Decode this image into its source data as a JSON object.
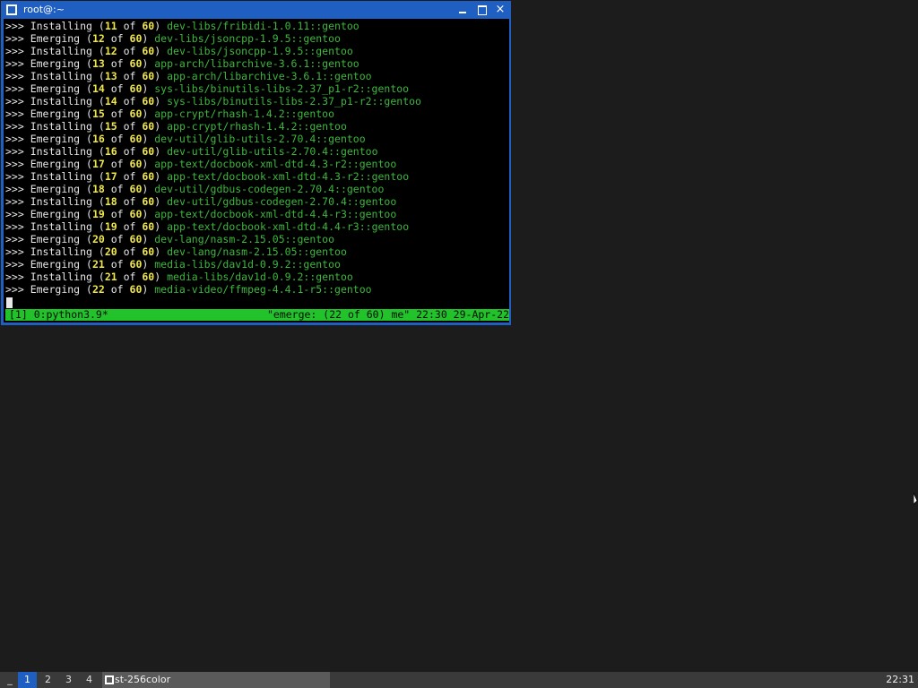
{
  "window": {
    "title": "root@:~",
    "minimize_label": "minimize",
    "maximize_label": "maximize",
    "close_label": "×"
  },
  "terminal": {
    "lines": [
      {
        "prompt": ">>> ",
        "verb": "Installing",
        "num": "11",
        "total": "60",
        "pkg": "dev-libs/fribidi-1.0.11::gentoo"
      },
      {
        "prompt": ">>> ",
        "verb": "Emerging",
        "num": "12",
        "total": "60",
        "pkg": "dev-libs/jsoncpp-1.9.5::gentoo"
      },
      {
        "prompt": ">>> ",
        "verb": "Installing",
        "num": "12",
        "total": "60",
        "pkg": "dev-libs/jsoncpp-1.9.5::gentoo"
      },
      {
        "prompt": ">>> ",
        "verb": "Emerging",
        "num": "13",
        "total": "60",
        "pkg": "app-arch/libarchive-3.6.1::gentoo"
      },
      {
        "prompt": ">>> ",
        "verb": "Installing",
        "num": "13",
        "total": "60",
        "pkg": "app-arch/libarchive-3.6.1::gentoo"
      },
      {
        "prompt": ">>> ",
        "verb": "Emerging",
        "num": "14",
        "total": "60",
        "pkg": "sys-libs/binutils-libs-2.37_p1-r2::gentoo"
      },
      {
        "prompt": ">>> ",
        "verb": "Installing",
        "num": "14",
        "total": "60",
        "pkg": "sys-libs/binutils-libs-2.37_p1-r2::gentoo"
      },
      {
        "prompt": ">>> ",
        "verb": "Emerging",
        "num": "15",
        "total": "60",
        "pkg": "app-crypt/rhash-1.4.2::gentoo"
      },
      {
        "prompt": ">>> ",
        "verb": "Installing",
        "num": "15",
        "total": "60",
        "pkg": "app-crypt/rhash-1.4.2::gentoo"
      },
      {
        "prompt": ">>> ",
        "verb": "Emerging",
        "num": "16",
        "total": "60",
        "pkg": "dev-util/glib-utils-2.70.4::gentoo"
      },
      {
        "prompt": ">>> ",
        "verb": "Installing",
        "num": "16",
        "total": "60",
        "pkg": "dev-util/glib-utils-2.70.4::gentoo"
      },
      {
        "prompt": ">>> ",
        "verb": "Emerging",
        "num": "17",
        "total": "60",
        "pkg": "app-text/docbook-xml-dtd-4.3-r2::gentoo"
      },
      {
        "prompt": ">>> ",
        "verb": "Installing",
        "num": "17",
        "total": "60",
        "pkg": "app-text/docbook-xml-dtd-4.3-r2::gentoo"
      },
      {
        "prompt": ">>> ",
        "verb": "Emerging",
        "num": "18",
        "total": "60",
        "pkg": "dev-util/gdbus-codegen-2.70.4::gentoo"
      },
      {
        "prompt": ">>> ",
        "verb": "Installing",
        "num": "18",
        "total": "60",
        "pkg": "dev-util/gdbus-codegen-2.70.4::gentoo"
      },
      {
        "prompt": ">>> ",
        "verb": "Emerging",
        "num": "19",
        "total": "60",
        "pkg": "app-text/docbook-xml-dtd-4.4-r3::gentoo"
      },
      {
        "prompt": ">>> ",
        "verb": "Installing",
        "num": "19",
        "total": "60",
        "pkg": "app-text/docbook-xml-dtd-4.4-r3::gentoo"
      },
      {
        "prompt": ">>> ",
        "verb": "Emerging",
        "num": "20",
        "total": "60",
        "pkg": "dev-lang/nasm-2.15.05::gentoo"
      },
      {
        "prompt": ">>> ",
        "verb": "Installing",
        "num": "20",
        "total": "60",
        "pkg": "dev-lang/nasm-2.15.05::gentoo"
      },
      {
        "prompt": ">>> ",
        "verb": "Emerging",
        "num": "21",
        "total": "60",
        "pkg": "media-libs/dav1d-0.9.2::gentoo"
      },
      {
        "prompt": ">>> ",
        "verb": "Installing",
        "num": "21",
        "total": "60",
        "pkg": "media-libs/dav1d-0.9.2::gentoo"
      },
      {
        "prompt": ">>> ",
        "verb": "Emerging",
        "num": "22",
        "total": "60",
        "pkg": "media-video/ffmpeg-4.4.1-r5::gentoo"
      }
    ],
    "status_left": "[1] 0:python3.9*",
    "status_right": "\"emerge: (22 of 60) me\" 22:30 29-Apr-22"
  },
  "taskbar": {
    "menu_label": "_",
    "workspaces": [
      "1",
      "2",
      "3",
      "4"
    ],
    "active_workspace": "1",
    "task_label": "st-256color",
    "clock": "22:31"
  },
  "colors": {
    "accent": "#1f5fc2",
    "status_bar": "#22c22a",
    "number": "#f0e84a",
    "package": "#3cb83c"
  }
}
